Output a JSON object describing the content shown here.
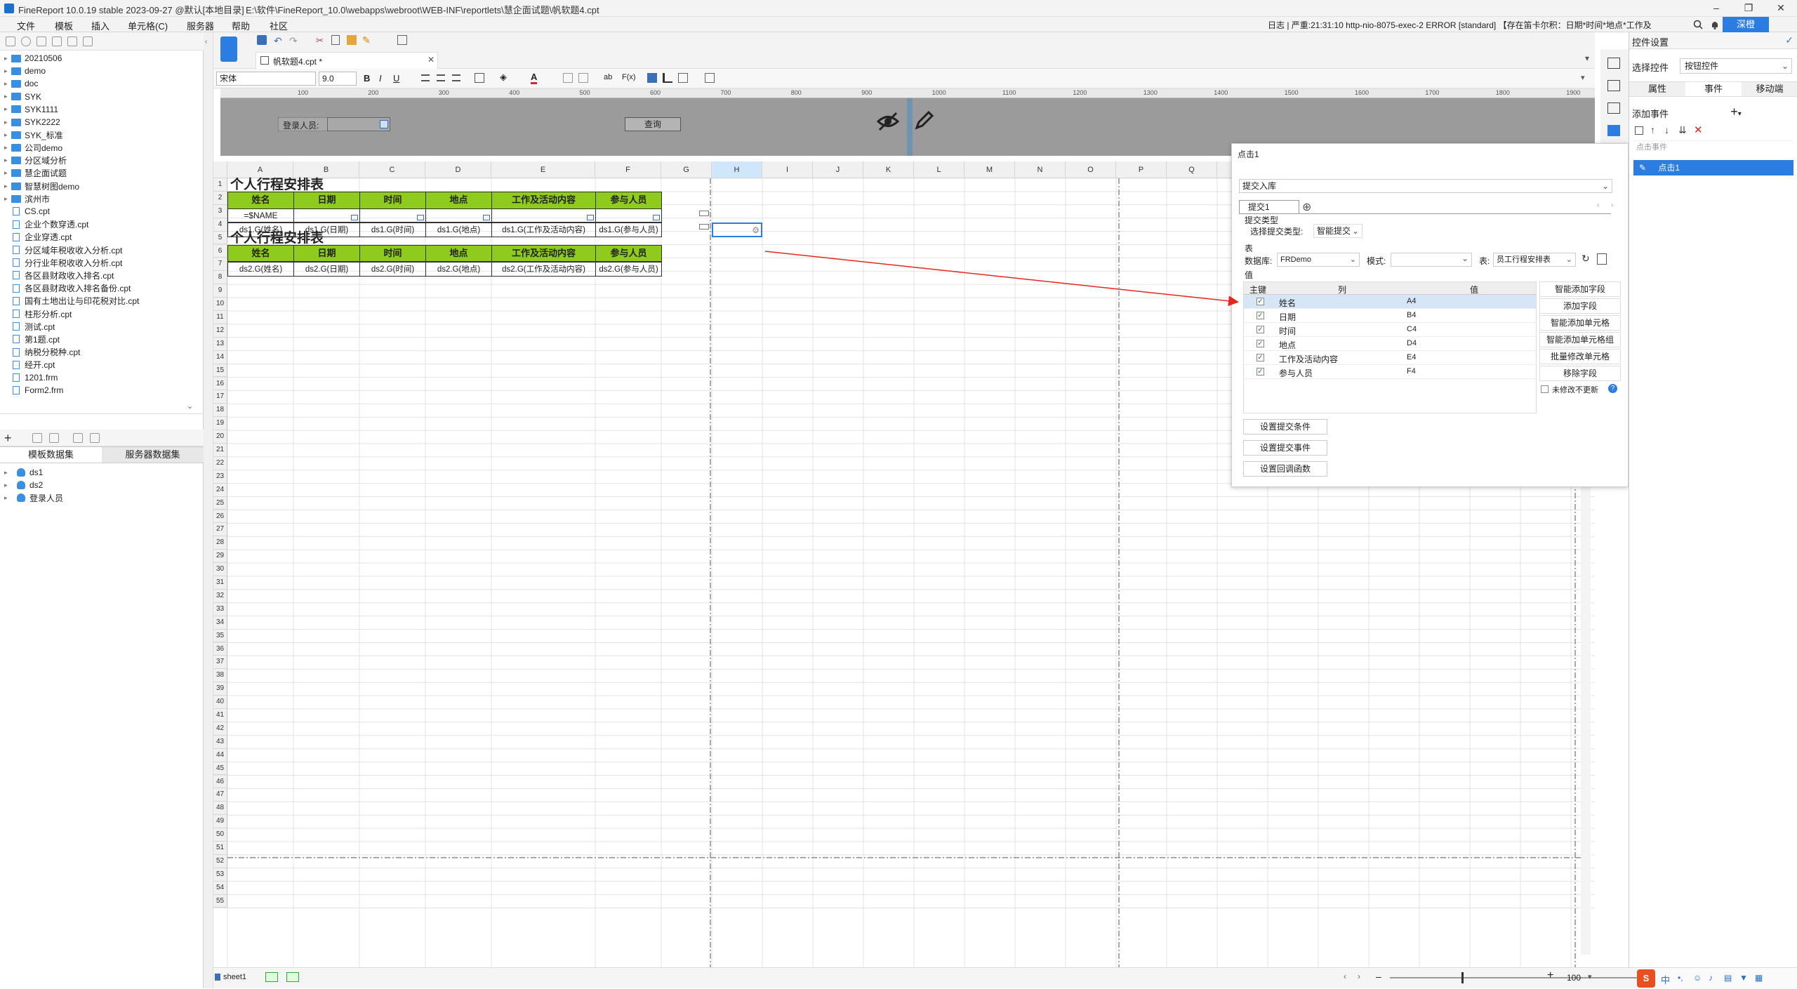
{
  "window": {
    "title": "FineReport 10.0.19 stable 2023-09-27 @默认[本地目录]",
    "path": "E:\\软件\\FineReport_10.0\\webapps\\webroot\\WEB-INF\\reportlets\\慧企面试题\\帆软题4.cpt"
  },
  "menubar": {
    "items": [
      "文件",
      "模板",
      "插入",
      "单元格(C)",
      "服务器",
      "帮助",
      "社区"
    ],
    "log": "日志 | 严重:21:31:10 http-nio-8075-exec-2 ERROR [standard] 【存在笛卡尔积：日期*时间*地点*工作及",
    "user_btn": "深橙"
  },
  "leftpanel": {
    "tree": [
      {
        "type": "folder",
        "label": "20210506"
      },
      {
        "type": "folder",
        "label": "demo"
      },
      {
        "type": "folder",
        "label": "doc"
      },
      {
        "type": "folder",
        "label": "SYK"
      },
      {
        "type": "folder",
        "label": "SYK1111"
      },
      {
        "type": "folder",
        "label": "SYK2222"
      },
      {
        "type": "folder",
        "label": "SYK_标准"
      },
      {
        "type": "folder",
        "label": "公司demo"
      },
      {
        "type": "folder",
        "label": "分区域分析"
      },
      {
        "type": "folder",
        "label": "慧企面试题"
      },
      {
        "type": "folder",
        "label": "智慧树图demo"
      },
      {
        "type": "folder",
        "label": "滨州市"
      },
      {
        "type": "file",
        "label": "CS.cpt"
      },
      {
        "type": "file",
        "label": "企业个数穿透.cpt"
      },
      {
        "type": "file",
        "label": "企业穿透.cpt"
      },
      {
        "type": "file",
        "label": "分区域年税收收入分析.cpt"
      },
      {
        "type": "file",
        "label": "分行业年税收收入分析.cpt"
      },
      {
        "type": "file",
        "label": "各区县财政收入排名.cpt"
      },
      {
        "type": "file",
        "label": "各区县财政收入排名备份.cpt"
      },
      {
        "type": "file",
        "label": "国有土地出让与印花税对比.cpt"
      },
      {
        "type": "file",
        "label": "柱形分析.cpt"
      },
      {
        "type": "file",
        "label": "测试.cpt"
      },
      {
        "type": "file",
        "label": "第1题.cpt"
      },
      {
        "type": "file",
        "label": "纳税分税种.cpt"
      },
      {
        "type": "file",
        "label": "经开.cpt"
      },
      {
        "type": "file",
        "label": "1201.frm"
      },
      {
        "type": "file",
        "label": "Form2.frm"
      }
    ],
    "ds_tabs": [
      "模板数据集",
      "服务器数据集"
    ],
    "datasets": [
      "ds1",
      "ds2",
      "登录人员"
    ]
  },
  "editor": {
    "tab": "帆软题4.cpt *",
    "font": "宋体",
    "size": "9.0",
    "ruler": [
      "100",
      "200",
      "300",
      "400",
      "500",
      "600",
      "700",
      "800",
      "900",
      "1000",
      "1100",
      "1200",
      "1300",
      "1400",
      "1500",
      "1600",
      "1700",
      "1800",
      "1900"
    ],
    "param": {
      "login_label": "登录人员:",
      "query_btn": "查询"
    }
  },
  "grid": {
    "cols": [
      "A",
      "B",
      "C",
      "D",
      "E",
      "F",
      "G",
      "H",
      "I",
      "J",
      "K",
      "L",
      "M",
      "N",
      "O",
      "P",
      "Q"
    ],
    "title1": "个人行程安排表",
    "title2": "个人行程安排表",
    "headers": [
      "姓名",
      "日期",
      "时间",
      "地点",
      "工作及活动内容",
      "参与人员"
    ],
    "row3a": "=$NAME",
    "row4": [
      "ds1.G(姓名)",
      "ds1.G(日期)",
      "ds1.G(时间)",
      "ds1.G(地点)",
      "ds1.G(工作及活动内容)",
      "ds1.G(参与人员)"
    ],
    "row7": [
      "ds2.G(姓名)",
      "ds2.G(日期)",
      "ds2.G(时间)",
      "ds2.G(地点)",
      "ds2.G(工作及活动内容)",
      "ds2.G(参与人员)"
    ]
  },
  "dialog": {
    "title": "点击1",
    "action": "提交入库",
    "tab": "提交1",
    "submit_type_hdr": "提交类型",
    "select_type_label": "选择提交类型:",
    "select_type_val": "智能提交",
    "table_hdr": "表",
    "datasource_label": "数据库:",
    "datasource_val": "FRDemo",
    "mode_label": "模式:",
    "table_label": "表:",
    "table_val": "员工行程安排表",
    "value_hdr": "值",
    "col_key": "主键",
    "col_col": "列",
    "col_val": "值",
    "rows": [
      {
        "col": "姓名",
        "val": "A4"
      },
      {
        "col": "日期",
        "val": "B4"
      },
      {
        "col": "时间",
        "val": "C4"
      },
      {
        "col": "地点",
        "val": "D4"
      },
      {
        "col": "工作及活动内容",
        "val": "E4"
      },
      {
        "col": "参与人员",
        "val": "F4"
      }
    ],
    "side_btns": [
      "智能添加字段",
      "添加字段",
      "智能添加单元格",
      "智能添加单元格组",
      "批量修改单元格",
      "移除字段"
    ],
    "nochange": "未修改不更新",
    "foot_btns": [
      "设置提交条件",
      "设置提交事件",
      "设置回调函数"
    ]
  },
  "rightpanel": {
    "title": "控件设置",
    "select_label": "选择控件",
    "select_val": "按钮控件",
    "tabs": [
      "属性",
      "事件",
      "移动端"
    ],
    "add_event": "添加事件",
    "event_group": "点击事件",
    "event_item": "点击1"
  },
  "status": {
    "sheet": "sheet1",
    "zoom": "100"
  }
}
